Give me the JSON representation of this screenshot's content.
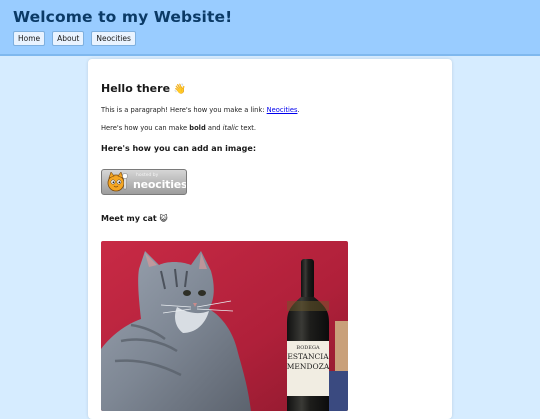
{
  "header": {
    "title": "Welcome to my Website!",
    "nav": [
      "Home",
      "About",
      "Neocities"
    ]
  },
  "content": {
    "heading": "Hello there",
    "heading_emoji": "👋",
    "p1_text": "This is a paragraph! Here's how you make a link: ",
    "p1_link": "Neocities",
    "p1_end": ".",
    "p2_prefix": "Here's how you can make ",
    "p2_bold": "bold",
    "p2_mid": " and ",
    "p2_italic": "italic",
    "p2_end": " text.",
    "image_heading": "Here's how you can add an image:",
    "badge_small": "hosted by",
    "badge_big": "neocities",
    "cat_heading": "Meet my cat",
    "cat_emoji": "😺",
    "bottle_label_top": "BODEGA",
    "bottle_label_line1": "ESTANCIA",
    "bottle_label_line2": "MENDOZA"
  },
  "colors": {
    "page_bg": "#d6ecff",
    "header_bg": "#99ccff",
    "title": "#0b3a66",
    "link": "#0000ee",
    "wall": "#b8213a"
  }
}
